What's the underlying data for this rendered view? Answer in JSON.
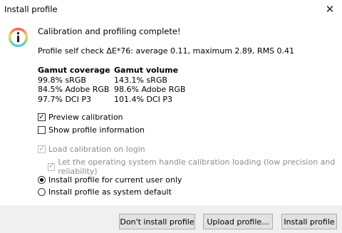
{
  "window": {
    "title": "Install profile"
  },
  "message": {
    "heading": "Calibration and profiling complete!",
    "self_check": "Profile self check ΔE*76: average 0.11, maximum 2.89, RMS 0.41"
  },
  "gamut": {
    "coverage_header": "Gamut coverage",
    "coverage": [
      "99.8% sRGB",
      "84.5% Adobe RGB",
      "97.7% DCI P3"
    ],
    "volume_header": "Gamut volume",
    "volume": [
      "143.1% sRGB",
      "98.6% Adobe RGB",
      "101.4% DCI P3"
    ]
  },
  "options": {
    "preview_calibration": {
      "label": "Preview calibration",
      "checked": true
    },
    "show_profile_info": {
      "label": "Show profile information",
      "checked": false
    },
    "load_calibration": {
      "label": "Load calibration on login",
      "checked": true,
      "enabled": false
    },
    "os_handle_calibration": {
      "label": "Let the operating system handle calibration loading (low precision and reliability)",
      "checked": true,
      "enabled": false
    }
  },
  "install_scope": {
    "current_user": {
      "label": "Install profile for current user only",
      "selected": true
    },
    "system_default": {
      "label": "Install profile as system default",
      "selected": false
    }
  },
  "buttons": {
    "dont_install": "Don't install profile",
    "upload": "Upload profile...",
    "install": "Install profile"
  },
  "icons": {
    "info": "info-icon",
    "close": "close-icon"
  },
  "colors": {
    "info_gradient_top": "#ff4b4b",
    "info_gradient_mid": "#ffd24a",
    "info_gradient_bottom": "#4fc3ff"
  }
}
